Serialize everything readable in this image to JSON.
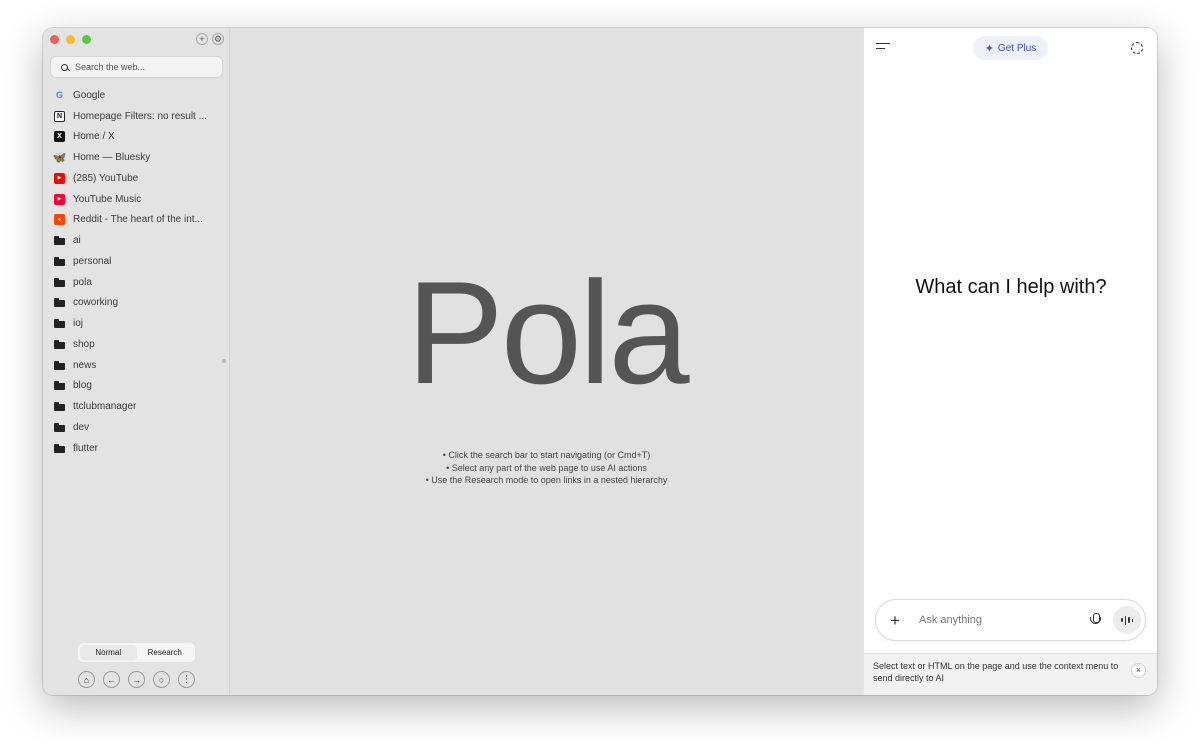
{
  "sidebar": {
    "top_buttons": {
      "new_tab": "+",
      "settings": "⚙"
    },
    "search": {
      "placeholder": "Search the web..."
    },
    "items": [
      {
        "label": "Google",
        "icon": "google-icon",
        "icon_glyph": "G"
      },
      {
        "label": "Homepage Filters: no result ...",
        "icon": "notion-icon",
        "icon_glyph": "N"
      },
      {
        "label": "Home / X",
        "icon": "x-icon",
        "icon_glyph": "X"
      },
      {
        "label": "Home — Bluesky",
        "icon": "bluesky-icon",
        "icon_glyph": "🦋"
      },
      {
        "label": "(285) YouTube",
        "icon": "youtube-icon",
        "icon_glyph": "▶"
      },
      {
        "label": "YouTube Music",
        "icon": "youtube-music-icon",
        "icon_glyph": "▶"
      },
      {
        "label": "Reddit - The heart of the int...",
        "icon": "reddit-icon",
        "icon_glyph": "●"
      },
      {
        "label": "ai",
        "icon": "folder-icon",
        "icon_glyph": ""
      },
      {
        "label": "personal",
        "icon": "folder-icon",
        "icon_glyph": ""
      },
      {
        "label": "pola",
        "icon": "folder-icon",
        "icon_glyph": ""
      },
      {
        "label": "coworking",
        "icon": "folder-icon",
        "icon_glyph": ""
      },
      {
        "label": "ioj",
        "icon": "folder-icon",
        "icon_glyph": ""
      },
      {
        "label": "shop",
        "icon": "folder-icon",
        "icon_glyph": ""
      },
      {
        "label": "news",
        "icon": "folder-icon",
        "icon_glyph": ""
      },
      {
        "label": "blog",
        "icon": "folder-icon",
        "icon_glyph": ""
      },
      {
        "label": "ttclubmanager",
        "icon": "folder-icon",
        "icon_glyph": ""
      },
      {
        "label": "dev",
        "icon": "folder-icon",
        "icon_glyph": ""
      },
      {
        "label": "flutter",
        "icon": "folder-icon",
        "icon_glyph": ""
      }
    ],
    "modes": {
      "normal": "Normal",
      "research": "Research",
      "active": "normal"
    },
    "bottom_icons": {
      "pin": "⌂",
      "back": "←",
      "forward": "→",
      "chat": "○",
      "more": "⋮"
    }
  },
  "main": {
    "logo": "Pola",
    "tips": [
      "• Click the search bar to start navigating (or Cmd+T)",
      "• Select any part of the web page to use AI actions",
      "• Use the Research mode to open links in a nested hierarchy"
    ]
  },
  "ai_panel": {
    "get_plus": "Get Plus",
    "get_plus_glyph": "✦",
    "headline": "What can I help with?",
    "composer": {
      "plus": "+",
      "placeholder": "Ask anything"
    },
    "hint": "Select text or HTML on the page and use the context menu to send directly to AI",
    "hint_close": "×"
  },
  "colors": {
    "accent": "#4a52c7",
    "accent_bg": "#eef0fb",
    "sidebar_bg": "#e3e3e3",
    "main_bg": "#e1e1e1",
    "logo": "#555555"
  }
}
